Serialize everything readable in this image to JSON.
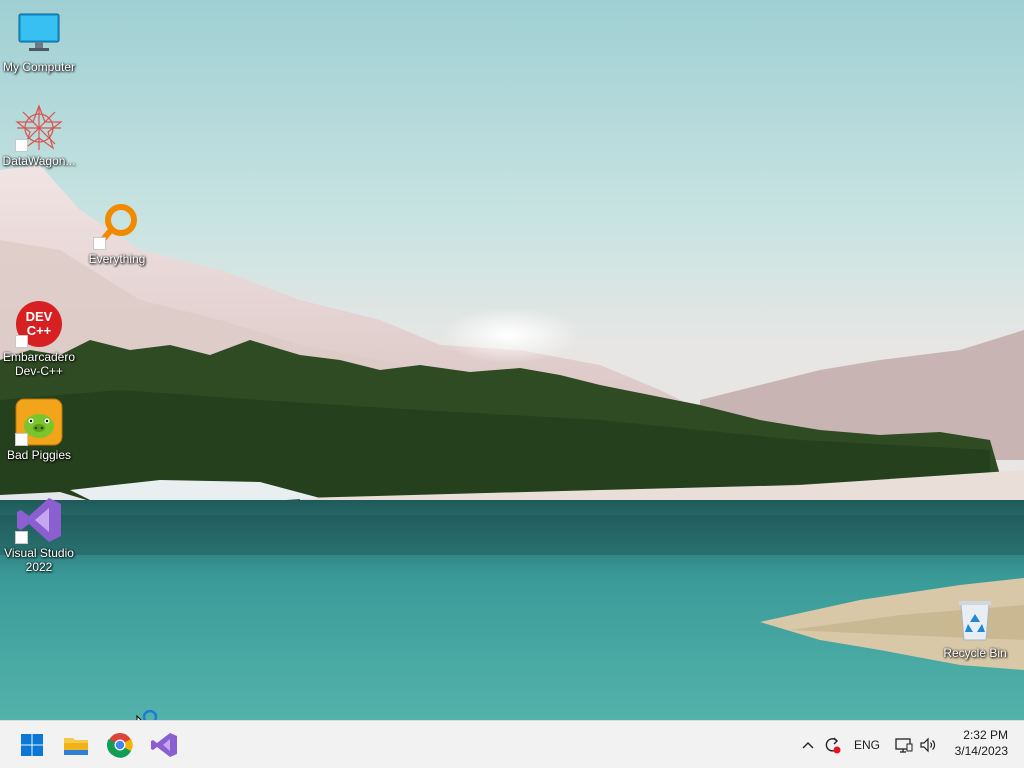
{
  "desktop": {
    "icons": [
      {
        "name": "my-computer",
        "label": "My Computer"
      },
      {
        "name": "datawagon",
        "label": "DataWagon..."
      },
      {
        "name": "everything",
        "label": "Everything"
      },
      {
        "name": "devcpp",
        "label": "Embarcadero\nDev-C++",
        "icon_text": "DEV\nC++"
      },
      {
        "name": "bad-piggies",
        "label": "Bad Piggies"
      },
      {
        "name": "visual-studio",
        "label": "Visual Studio\n2022"
      },
      {
        "name": "recycle-bin",
        "label": "Recycle Bin"
      }
    ]
  },
  "taskbar": {
    "apps": [
      "start",
      "file-explorer",
      "chrome",
      "visual-studio"
    ],
    "tray": {
      "language": "ENG",
      "icons": [
        "chevron-up-icon",
        "sync-icon",
        "network-icon",
        "volume-icon"
      ]
    },
    "clock": {
      "time": "2:32 PM",
      "date": "3/14/2023"
    }
  },
  "colors": {
    "taskbar_bg": "#f2f2f2",
    "sky": "#b9dede",
    "water": "#2f8f90",
    "forest": "#2d4a22"
  }
}
